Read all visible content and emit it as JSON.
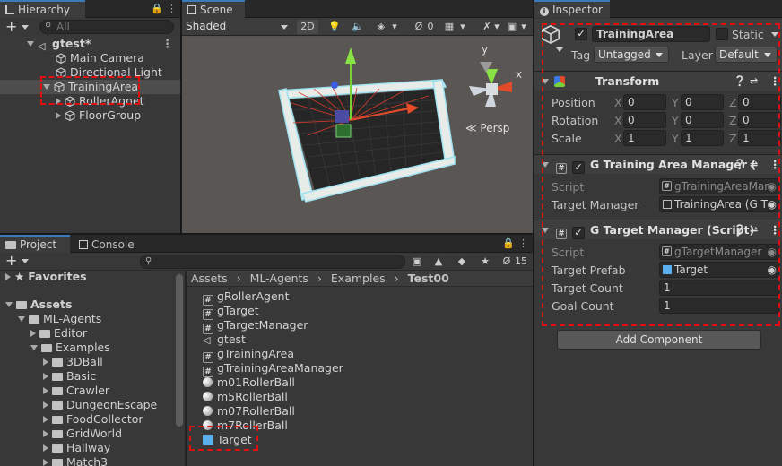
{
  "hierarchy": {
    "tab": "Hierarchy",
    "search_placeholder": "All",
    "items": [
      {
        "label": "gtest*",
        "depth": 0
      },
      {
        "label": "Main Camera",
        "depth": 1
      },
      {
        "label": "Directional Light",
        "depth": 1
      },
      {
        "label": "TrainingArea",
        "depth": 1
      },
      {
        "label": "RollerAgnet",
        "depth": 2
      },
      {
        "label": "FloorGroup",
        "depth": 2
      }
    ]
  },
  "scene": {
    "tab": "Scene",
    "shading": "Shaded",
    "mode_2d": "2D",
    "hidden_count": "0",
    "persp": "Persp",
    "gizmo_labels": {
      "y": "y",
      "x": "x"
    }
  },
  "project": {
    "tab_project": "Project",
    "tab_console": "Console",
    "hidden_count": "15",
    "favorites": "Favorites",
    "assets": "Assets",
    "tree": [
      "ML-Agents",
      "Editor",
      "Examples",
      "3DBall",
      "Basic",
      "Crawler",
      "DungeonEscape",
      "FoodCollector",
      "GridWorld",
      "Hallway",
      "Match3"
    ],
    "breadcrumb": [
      "Assets",
      "ML-Agents",
      "Examples",
      "Test00"
    ],
    "files": [
      {
        "name": "gRollerAgent",
        "icon": "script-icon"
      },
      {
        "name": "gTarget",
        "icon": "script-icon"
      },
      {
        "name": "gTargetManager",
        "icon": "script-icon"
      },
      {
        "name": "gtest",
        "icon": "unity-scene-icon"
      },
      {
        "name": "gTrainingArea",
        "icon": "script-icon"
      },
      {
        "name": "gTrainingAreaManager",
        "icon": "script-icon"
      },
      {
        "name": "m01RollerBall",
        "icon": "material-icon"
      },
      {
        "name": "m5RollerBall",
        "icon": "material-icon"
      },
      {
        "name": "m07RollerBall",
        "icon": "material-icon"
      },
      {
        "name": "m7RollerBall",
        "icon": "material-icon"
      },
      {
        "name": "Target",
        "icon": "prefab-icon"
      }
    ]
  },
  "inspector": {
    "tab": "Inspector",
    "object_name": "TrainingArea",
    "static_label": "Static",
    "tag_label": "Tag",
    "tag_value": "Untagged",
    "layer_label": "Layer",
    "layer_value": "Default",
    "transform": {
      "title": "Transform",
      "position": {
        "label": "Position",
        "x": "0",
        "y": "0",
        "z": "0"
      },
      "rotation": {
        "label": "Rotation",
        "x": "0",
        "y": "0",
        "z": "0"
      },
      "scale": {
        "label": "Scale",
        "x": "1",
        "y": "1",
        "z": "1"
      },
      "axis": {
        "x": "X",
        "y": "Y",
        "z": "Z"
      }
    },
    "comp1": {
      "title": "G Training Area Manager (",
      "script_label": "Script",
      "script_value": "gTrainingAreaMar",
      "tm_label": "Target Manager",
      "tm_value": "TrainingArea (G T"
    },
    "comp2": {
      "title": "G Target Manager (Script)",
      "script_label": "Script",
      "script_value": "gTargetManager",
      "prefab_label": "Target Prefab",
      "prefab_value": "Target",
      "count_label": "Target Count",
      "count_value": "1",
      "goal_label": "Goal Count",
      "goal_value": "1"
    },
    "add_component": "Add Component"
  },
  "colors": {
    "accent": "#3a79bb",
    "highlight": "#e01010",
    "panel": "#383838"
  }
}
